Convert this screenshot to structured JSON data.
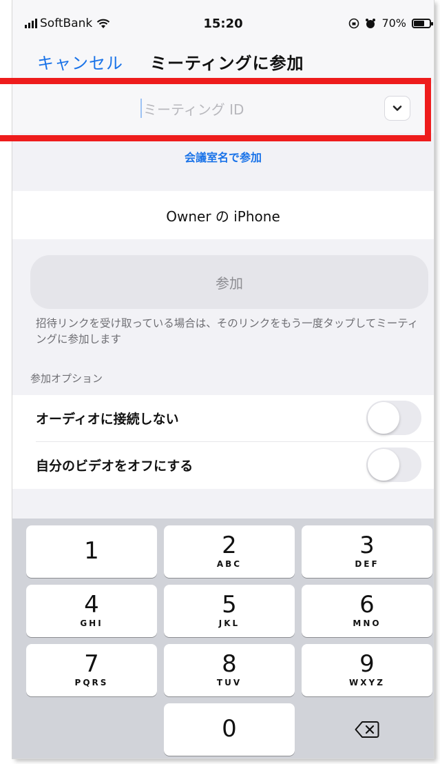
{
  "status_bar": {
    "carrier": "SoftBank",
    "time": "15:20",
    "battery": "70%",
    "battery_level": 0.7
  },
  "nav": {
    "cancel_label": "キャンセル",
    "title": "ミーティングに参加"
  },
  "meeting_id": {
    "placeholder": "ミーティング ID",
    "dropdown_icon": "chevron-down-icon",
    "join_by_room_label": "会議室名で参加"
  },
  "device_name": "Owner の iPhone",
  "join_button_label": "参加",
  "join_hint": "招待リンクを受け取っている場合は、そのリンクをもう一度タップしてミーティングに参加します",
  "options": {
    "header": "参加オプション",
    "items": [
      {
        "label": "オーディオに接続しない",
        "enabled": false
      },
      {
        "label": "自分のビデオをオフにする",
        "enabled": false
      }
    ]
  },
  "keypad": {
    "keys": [
      {
        "digit": "1",
        "letters": ""
      },
      {
        "digit": "2",
        "letters": "ABC"
      },
      {
        "digit": "3",
        "letters": "DEF"
      },
      {
        "digit": "4",
        "letters": "GHI"
      },
      {
        "digit": "5",
        "letters": "JKL"
      },
      {
        "digit": "6",
        "letters": "MNO"
      },
      {
        "digit": "7",
        "letters": "PQRS"
      },
      {
        "digit": "8",
        "letters": "TUV"
      },
      {
        "digit": "9",
        "letters": "WXYZ"
      },
      {
        "digit": "0",
        "letters": ""
      }
    ],
    "delete_icon": "backspace-icon"
  },
  "colors": {
    "accent": "#1a73e8",
    "highlight": "#ee1c1c"
  }
}
